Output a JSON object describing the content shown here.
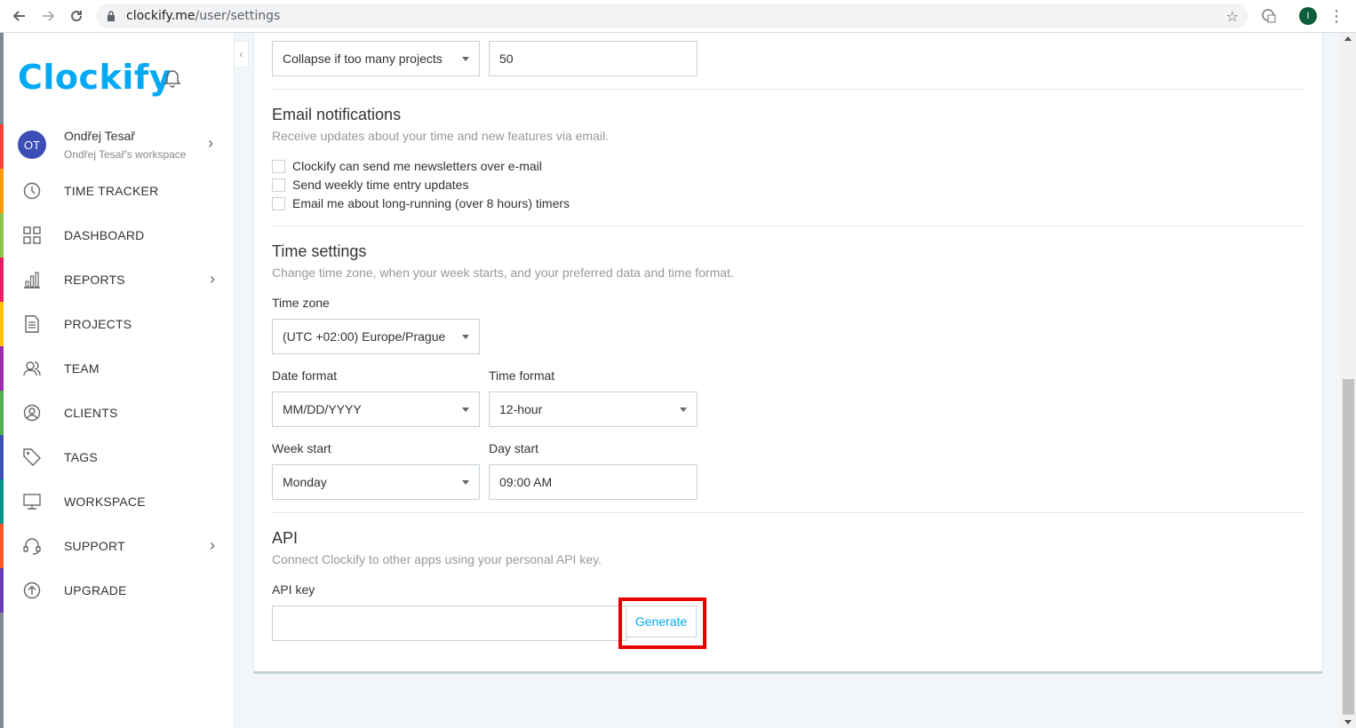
{
  "browser": {
    "url_host": "clockify.me",
    "url_path": "/user/settings",
    "profile_initial": "I"
  },
  "sidebar": {
    "logo_text": "Clockify",
    "user": {
      "initials": "OT",
      "name": "Ondřej Tesař",
      "workspace": "Ondřej Tesař's workspace"
    },
    "items": [
      {
        "label": "TIME TRACKER",
        "icon": "clock-icon",
        "color": "#fd9b0a",
        "has_chevron": false
      },
      {
        "label": "DASHBOARD",
        "icon": "grid-icon",
        "color": "#8bc34a",
        "has_chevron": false
      },
      {
        "label": "REPORTS",
        "icon": "bar-chart-icon",
        "color": "#e91e63",
        "has_chevron": true
      },
      {
        "label": "PROJECTS",
        "icon": "document-icon",
        "color": "#ffc107",
        "has_chevron": false
      },
      {
        "label": "TEAM",
        "icon": "team-icon",
        "color": "#9c27b0",
        "has_chevron": false
      },
      {
        "label": "CLIENTS",
        "icon": "user-circle-icon",
        "color": "#4caf50",
        "has_chevron": false
      },
      {
        "label": "TAGS",
        "icon": "tag-icon",
        "color": "#3f51b5",
        "has_chevron": false
      },
      {
        "label": "WORKSPACE",
        "icon": "monitor-icon",
        "color": "#009688",
        "has_chevron": false
      },
      {
        "label": "SUPPORT",
        "icon": "headset-icon",
        "color": "#ff5722",
        "has_chevron": true
      },
      {
        "label": "UPGRADE",
        "icon": "upgrade-arrow-icon",
        "color": "#673ab7",
        "has_chevron": false
      }
    ],
    "top_strip_color": "#f44336"
  },
  "settings": {
    "project_grouping": {
      "value": "Collapse if too many projects",
      "threshold": "50"
    },
    "email": {
      "title": "Email notifications",
      "description": "Receive updates about your time and new features via email.",
      "options": [
        {
          "label": "Clockify can send me newsletters over e-mail",
          "checked": false
        },
        {
          "label": "Send weekly time entry updates",
          "checked": false
        },
        {
          "label": "Email me about long-running (over 8 hours) timers",
          "checked": false
        }
      ]
    },
    "time": {
      "title": "Time settings",
      "description": "Change time zone, when your week starts, and your preferred data and time format.",
      "timezone_label": "Time zone",
      "timezone_value": "(UTC +02:00) Europe/Prague",
      "date_format_label": "Date format",
      "date_format_value": "MM/DD/YYYY",
      "time_format_label": "Time format",
      "time_format_value": "12-hour",
      "week_start_label": "Week start",
      "week_start_value": "Monday",
      "day_start_label": "Day start",
      "day_start_value": "09:00 AM"
    },
    "api": {
      "title": "API",
      "description": "Connect Clockify to other apps using your personal API key.",
      "key_label": "API key",
      "key_value": "",
      "generate_label": "Generate"
    }
  },
  "colors": {
    "accent": "#03a9f4",
    "highlight": "#e60000"
  }
}
